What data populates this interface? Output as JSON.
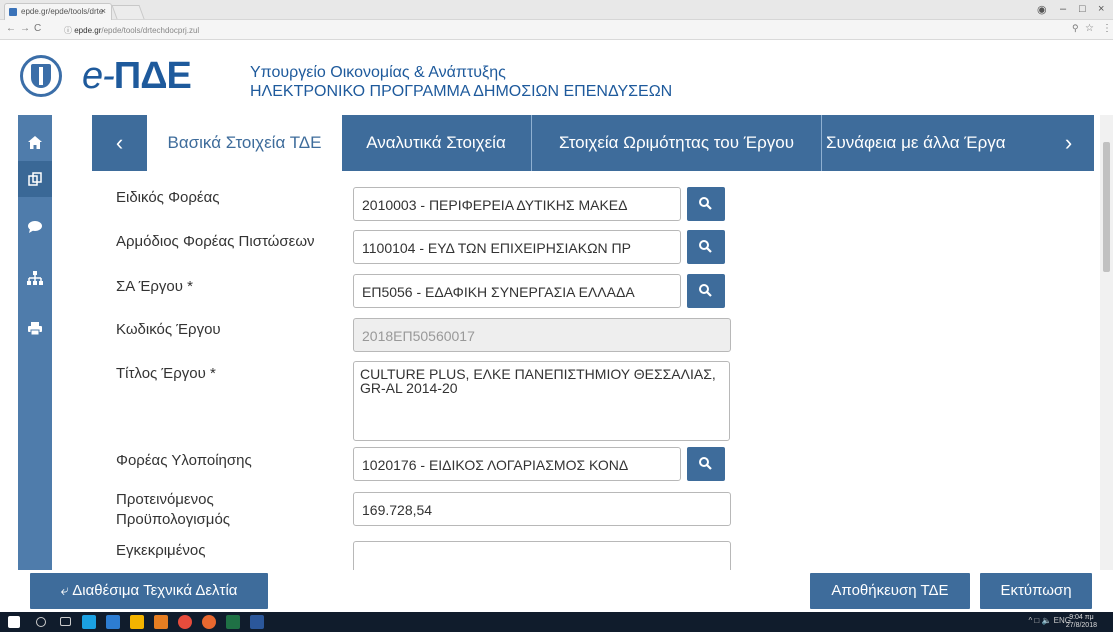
{
  "browser": {
    "tab_title": "epde.gr/epde/tools/drte",
    "url_host": "epde.gr",
    "url_path": "/epde/tools/drtechdocprj.zul"
  },
  "header": {
    "logo_text": "ΠΔΕ",
    "logo_prefix": "e-",
    "ministry": "Υπουργείο Οικονομίας & Ανάπτυξης",
    "program": "ΗΛΕΚΤΡΟΝΙΚΟ ΠΡΟΓΡΑΜΜΑ ΔΗΜΟΣΙΩΝ ΕΠΕΝΔΥΣΕΩΝ"
  },
  "tabs": {
    "prev": "‹",
    "next": "›",
    "items": [
      {
        "label": "Βασικά Στοιχεία ΤΔΕ"
      },
      {
        "label": "Αναλυτικά Στοιχεία"
      },
      {
        "label": "Στοιχεία Ωριμότητας του Έργου"
      },
      {
        "label": "Συνάφεια με άλλα Έργα"
      }
    ]
  },
  "form": {
    "fields": [
      {
        "label": "Ειδικός Φορέας",
        "value": "2010003 - ΠΕΡΙΦΕΡΕΙΑ ΔΥΤΙΚΗΣ ΜΑΚΕΔ"
      },
      {
        "label": "Αρμόδιος Φορέας Πιστώσεων",
        "value": "1100104 - ΕΥΔ ΤΩΝ ΕΠΙΧΕΙΡΗΣΙΑΚΩΝ ΠΡ"
      },
      {
        "label": "ΣΑ Έργου *",
        "value": "ΕΠ5056 - ΕΔΑΦΙΚΗ ΣΥΝΕΡΓΑΣΙΑ ΕΛΛΑΔΑ"
      },
      {
        "label": "Κωδικός Έργου",
        "value": "2018ΕΠ50560017"
      },
      {
        "label": "Τίτλος Έργου *",
        "value": "CULTURE PLUS, ΕΛΚΕ ΠΑΝΕΠΙΣΤΗΜΙΟΥ ΘΕΣΣΑΛΙΑΣ, GR-AL 2014-20"
      },
      {
        "label": "Φορέας Υλοποίησης",
        "value": "1020176 - ΕΙΔΙΚΟΣ ΛΟΓΑΡΙΑΣΜΟΣ ΚΟΝΔ"
      },
      {
        "label": "Προτεινόμενος Προϋπολογισμός",
        "value": "169.728,54"
      },
      {
        "label": "Εγκεκριμένος",
        "value": ""
      }
    ]
  },
  "footer": {
    "back_label": "Διαθέσιμα Τεχνικά Δελτία",
    "save_label": "Αποθήκευση ΤΔΕ",
    "print_label": "Εκτύπωση"
  },
  "taskbar": {
    "lang": "ENG",
    "time": "9:04 πμ",
    "date": "27/8/2018"
  },
  "colors": {
    "primary": "#3e6c9b",
    "sidebar": "#4f7cab",
    "brand": "#1e5a9c"
  }
}
